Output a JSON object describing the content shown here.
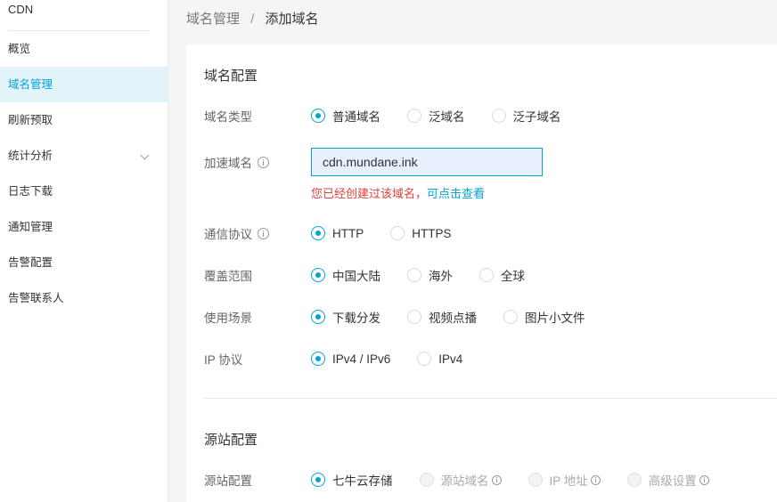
{
  "sidebar": {
    "brand": "CDN",
    "items": [
      {
        "label": "概览"
      },
      {
        "label": "域名管理"
      },
      {
        "label": "刷新预取"
      },
      {
        "label": "统计分析"
      },
      {
        "label": "日志下载"
      },
      {
        "label": "通知管理"
      },
      {
        "label": "告警配置"
      },
      {
        "label": "告警联系人"
      }
    ]
  },
  "breadcrumb": {
    "parent": "域名管理",
    "separator": "/",
    "current": "添加域名"
  },
  "domain_config": {
    "title": "域名配置",
    "domain_type": {
      "label": "域名类型",
      "options": [
        "普通域名",
        "泛域名",
        "泛子域名"
      ],
      "selected": "普通域名"
    },
    "accel_domain": {
      "label": "加速域名",
      "value": "cdn.mundane.ink",
      "error_text": "您已经创建过该域名，",
      "error_link": "可点击查看"
    },
    "protocol": {
      "label": "通信协议",
      "options": [
        "HTTP",
        "HTTPS"
      ],
      "selected": "HTTP"
    },
    "coverage": {
      "label": "覆盖范围",
      "options": [
        "中国大陆",
        "海外",
        "全球"
      ],
      "selected": "中国大陆"
    },
    "scenario": {
      "label": "使用场景",
      "options": [
        "下载分发",
        "视频点播",
        "图片小文件"
      ],
      "selected": "下载分发"
    },
    "ip_protocol": {
      "label": "IP 协议",
      "options": [
        "IPv4 / IPv6",
        "IPv4"
      ],
      "selected": "IPv4 / IPv6"
    }
  },
  "origin_config": {
    "title": "源站配置",
    "origin": {
      "label": "源站配置",
      "options": [
        "七牛云存储",
        "源站域名",
        "IP 地址",
        "高级设置"
      ],
      "selected": "七牛云存储"
    }
  },
  "colors": {
    "accent": "#00a4d8",
    "error": "#e0413d",
    "active_bg": "#e3f3fa"
  }
}
